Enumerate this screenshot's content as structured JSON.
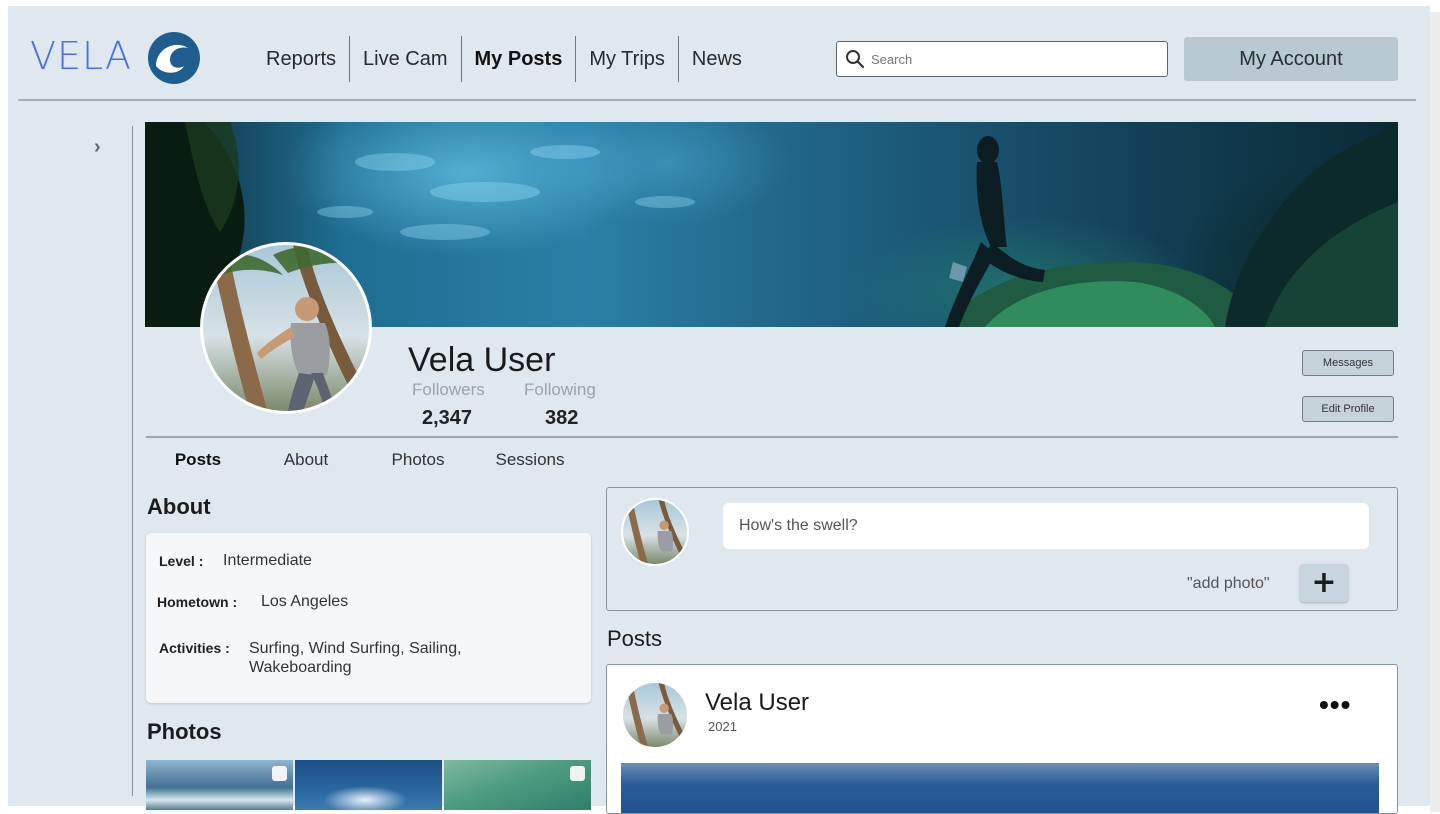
{
  "brand": {
    "name": "VELA",
    "accent": "#4a6ee8",
    "mark_color": "#1f5d8f"
  },
  "nav": {
    "items": [
      {
        "label": "Reports",
        "active": false
      },
      {
        "label": "Live Cam",
        "active": false
      },
      {
        "label": "My Posts",
        "active": true
      },
      {
        "label": "My Trips",
        "active": false
      },
      {
        "label": "News",
        "active": false
      }
    ]
  },
  "search": {
    "placeholder": "Search",
    "value": ""
  },
  "account": {
    "label": "My Account"
  },
  "sidebar": {
    "toggle_glyph": "›"
  },
  "profile": {
    "name": "Vela User",
    "followers_label": "Followers",
    "followers_value": "2,347",
    "following_label": "Following",
    "following_value": "382",
    "messages_label": "Messages",
    "edit_label": "Edit Profile"
  },
  "tabs": [
    {
      "label": "Posts",
      "active": true
    },
    {
      "label": "About",
      "active": false
    },
    {
      "label": "Photos",
      "active": false
    },
    {
      "label": "Sessions",
      "active": false
    }
  ],
  "about": {
    "heading": "About",
    "level_key": "Level :",
    "level_value": "Intermediate",
    "hometown_key": "Hometown :",
    "hometown_value": "Los Angeles",
    "activities_key": "Activities :",
    "activities_line1": "Surfing, Wind Surfing, Sailing,",
    "activities_line2": "Wakeboarding"
  },
  "photos": {
    "heading": "Photos"
  },
  "composer": {
    "placeholder": "How's the swell?",
    "add_photo_label": "\"add photo\"",
    "add_photo_glyph": "+"
  },
  "posts": {
    "heading": "Posts",
    "items": [
      {
        "author": "Vela User",
        "year": "2021",
        "menu_glyph": "•••"
      }
    ]
  }
}
